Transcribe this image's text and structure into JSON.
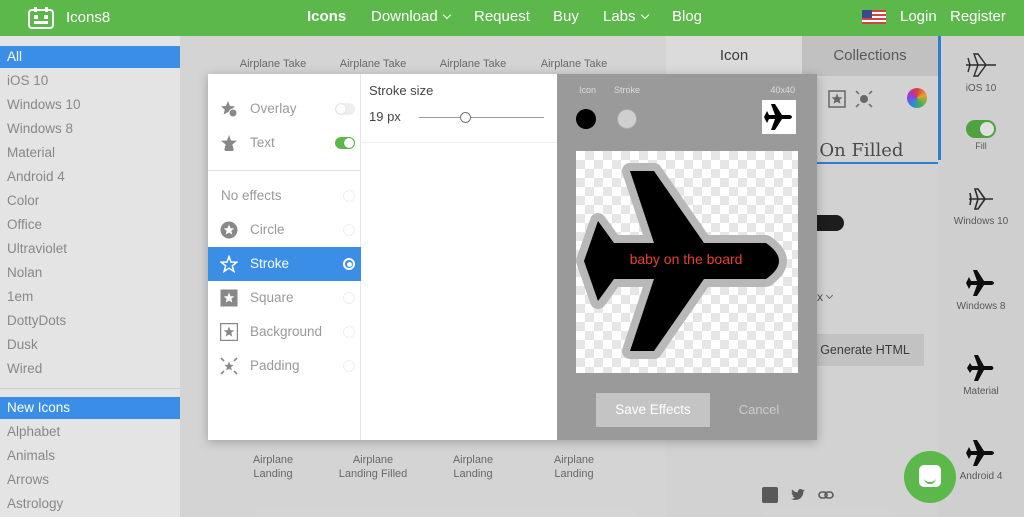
{
  "header": {
    "brand": "Icons8",
    "nav": [
      {
        "label": "Icons"
      },
      {
        "label": "Download"
      },
      {
        "label": "Request"
      },
      {
        "label": "Buy"
      },
      {
        "label": "Labs"
      },
      {
        "label": "Blog"
      }
    ],
    "login": "Login",
    "register": "Register"
  },
  "sidebar": {
    "styles": [
      "All",
      "iOS 10",
      "Windows 10",
      "Windows 8",
      "Material",
      "Android 4",
      "Color",
      "Office",
      "Ultraviolet",
      "Nolan",
      "1em",
      "DottyDots",
      "Dusk",
      "Wired"
    ],
    "categories": [
      "New Icons",
      "Alphabet",
      "Animals",
      "Arrows",
      "Astrology"
    ]
  },
  "grid": {
    "top_labels": [
      "Airplane Take",
      "Airplane Take",
      "Airplane Take",
      "Airplane Take"
    ],
    "bottom_labels": [
      {
        "l1": "Airplane",
        "l2": "Landing"
      },
      {
        "l1": "Airplane",
        "l2": "Landing Filled"
      },
      {
        "l1": "Airplane",
        "l2": "Landing"
      },
      {
        "l1": "Airplane",
        "l2": "Landing"
      }
    ]
  },
  "right_panel": {
    "tab_icon": "Icon",
    "tab_collections": "Collections",
    "heading_fragment": "e On Filled",
    "x_fragment": "x",
    "generate_html": "Generate HTML"
  },
  "far_right": {
    "items": [
      {
        "label": "iOS 10"
      },
      {
        "label": "Fill"
      },
      {
        "label": "Windows 10"
      },
      {
        "label": "Windows 8"
      },
      {
        "label": "Material"
      },
      {
        "label": "Android 4"
      }
    ]
  },
  "modal": {
    "overlay_label": "Overlay",
    "text_label": "Text",
    "effects": [
      {
        "label": "No effects"
      },
      {
        "label": "Circle"
      },
      {
        "label": "Stroke"
      },
      {
        "label": "Square"
      },
      {
        "label": "Background"
      },
      {
        "label": "Padding"
      }
    ],
    "stroke_size_title": "Stroke size",
    "stroke_size_value": "19 px",
    "stroke_slider_fraction": 0.37,
    "color_icon_label": "Icon",
    "color_stroke_label": "Stroke",
    "size_label": "40x40",
    "preview_text": "baby on the board",
    "save_label": "Save Effects",
    "cancel_label": "Cancel"
  },
  "colors": {
    "brand_green": "#5cb84a",
    "accent_blue": "#3a8ee6",
    "preview_text_red": "#e8412e"
  }
}
